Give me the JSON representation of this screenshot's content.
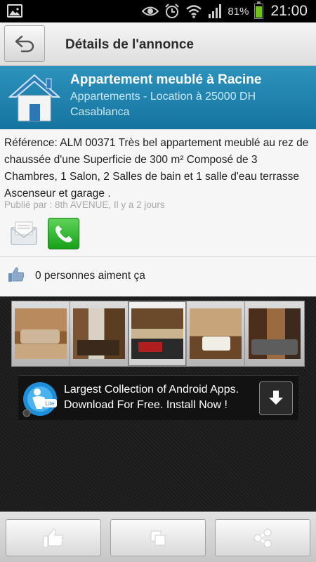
{
  "status_bar": {
    "battery_percent": "81%",
    "battery_level": 0.81,
    "time": "21:00",
    "icons": [
      "picture-icon",
      "eye-icon",
      "alarm-icon",
      "wifi-icon",
      "signal-icon",
      "battery-icon"
    ]
  },
  "header": {
    "title": "Détails de l'annonce",
    "back_icon": "back-arrow-icon"
  },
  "listing": {
    "title": "Appartement meublé à Racine",
    "subtitle": "Appartements - Location à 25000 DH",
    "city": "Casablanca",
    "icon": "house-icon",
    "description": "Référence: ALM 00371 Très bel appartement meublé au rez de chaussée d'une Superficie de 300 m² Composé de 3 Chambres, 1 Salon, 2 Salles de bain et 1 salle d'eau terrasse Ascenseur et garage .",
    "published": "Publié par : 8th AVENUE, Il y a 2 jours",
    "likes": "0 personnes aiment ça"
  },
  "gallery": {
    "photos": [
      "apartment-photo-1",
      "apartment-photo-2",
      "apartment-photo-3",
      "apartment-photo-4",
      "apartment-photo-5"
    ],
    "selected_index": 2
  },
  "ad": {
    "line1": "Largest Collection of Android Apps.",
    "line2": "Download For Free. Install Now !",
    "logo_badge": "Lite"
  },
  "bottom_bar": {
    "buttons": [
      "like-icon",
      "copy-icon",
      "share-icon"
    ]
  },
  "colors": {
    "listing_header": "#1f82af",
    "subtitle_text": "#cbe9f7",
    "phone_green": "#2bb02a",
    "battery_green": "#6ec21a"
  }
}
